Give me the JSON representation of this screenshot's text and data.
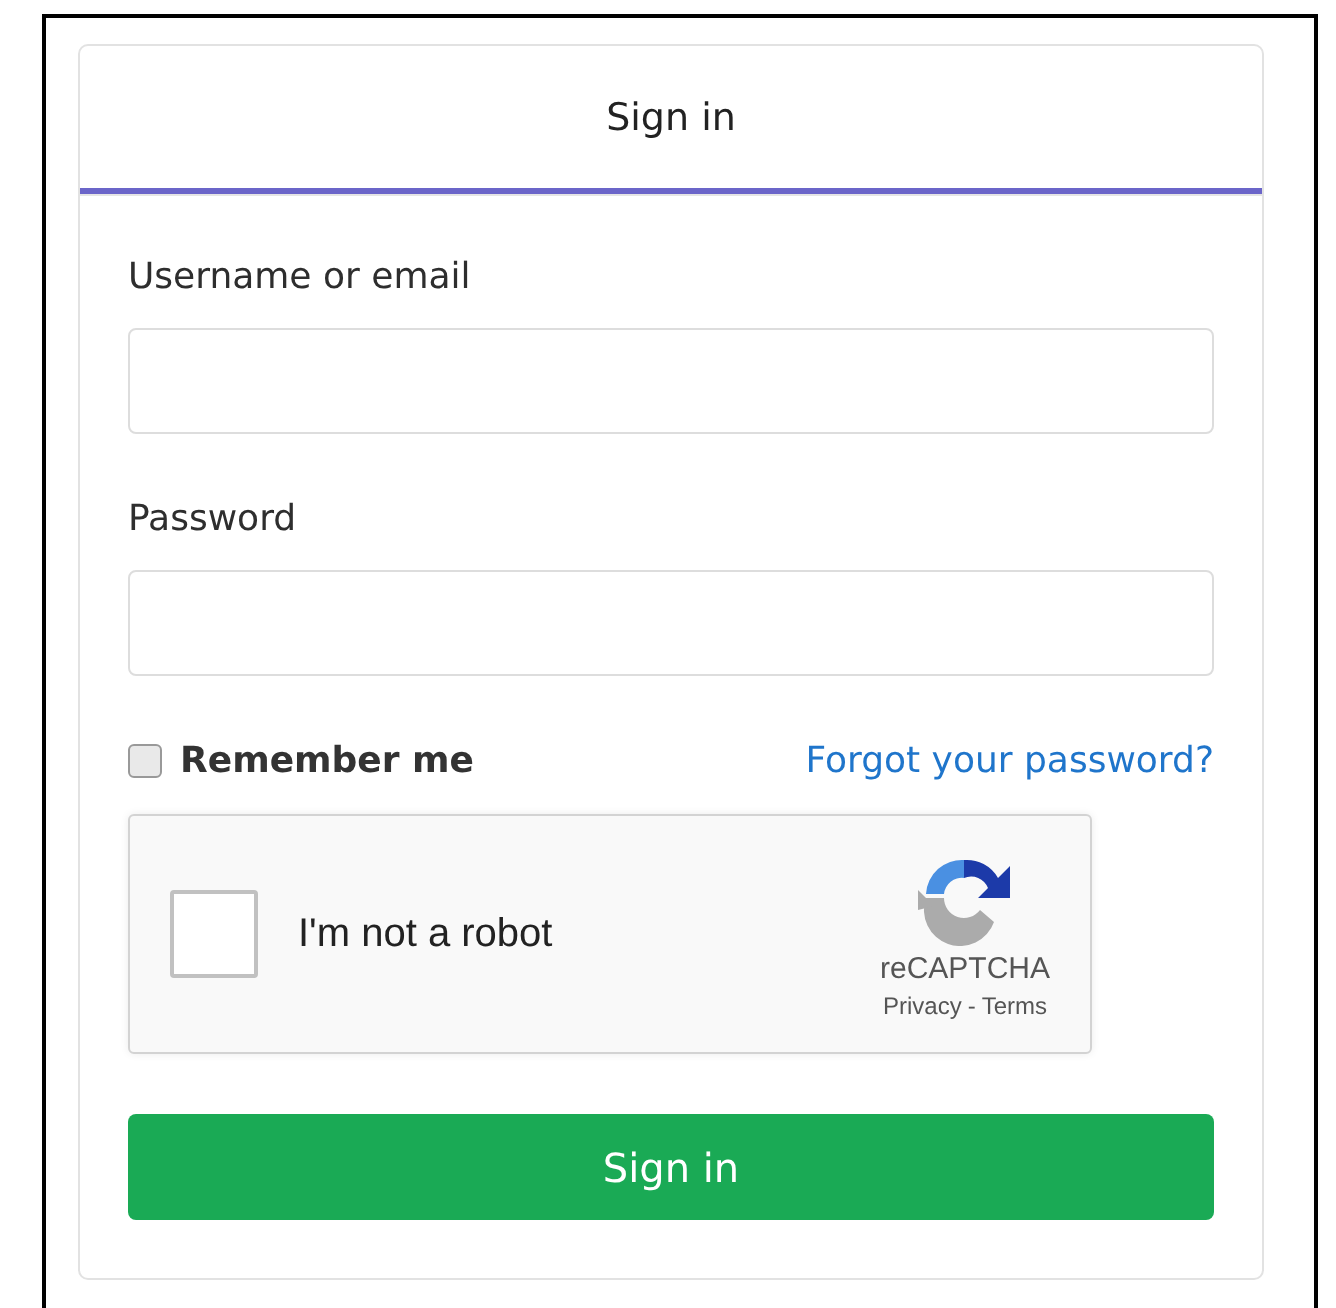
{
  "tabs": [
    {
      "label": "Sign in",
      "selected": true
    }
  ],
  "fields": [
    {
      "label": "Username or email"
    },
    {
      "label": "Password"
    }
  ],
  "remember": {
    "label": "Remember me",
    "checked": false
  },
  "forgot_link": "Forgot your password?",
  "captcha": {
    "label": "I'm not a robot",
    "checked": false,
    "brand": "reCAPTCHA",
    "privacy": "Privacy",
    "separator": "-",
    "terms": "Terms"
  },
  "submit": "Sign in"
}
